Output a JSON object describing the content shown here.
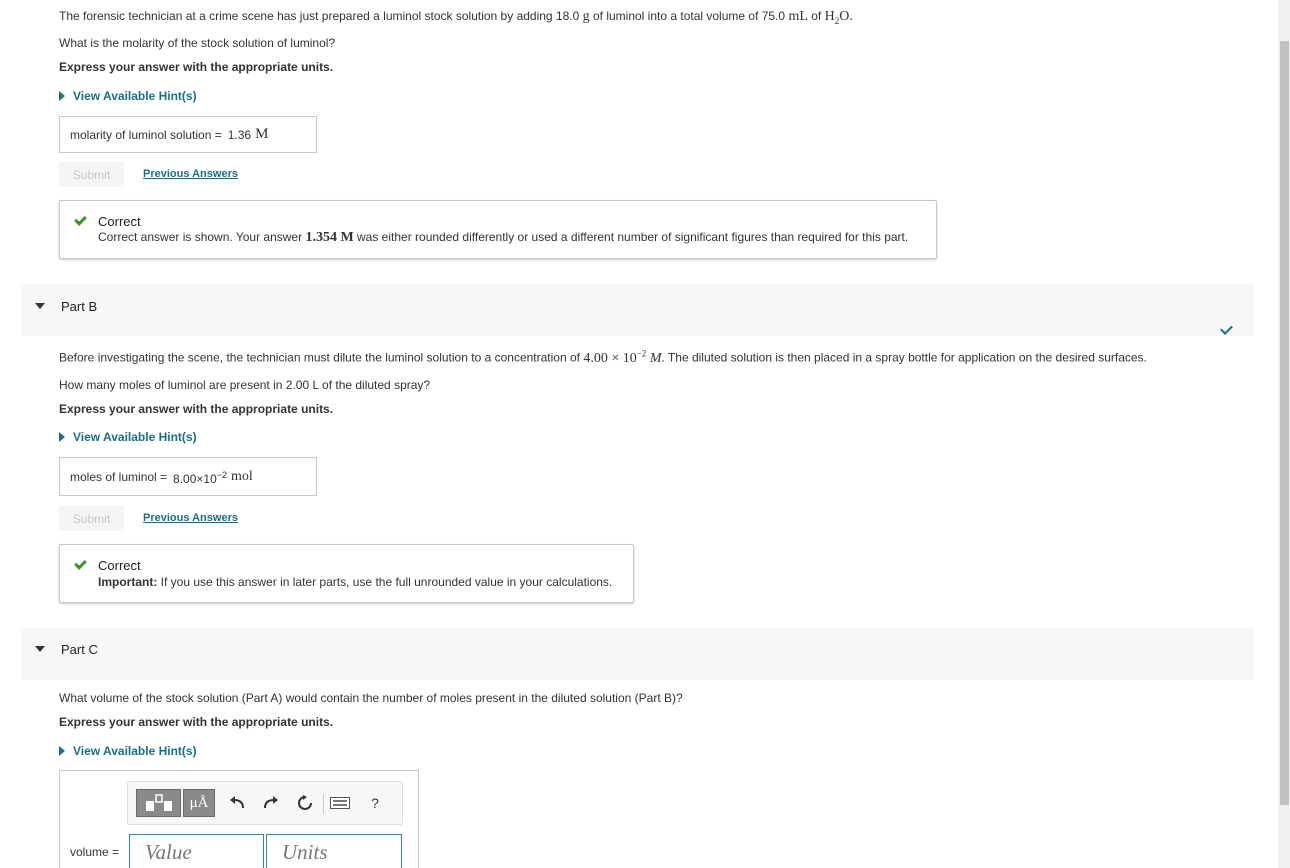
{
  "partA": {
    "question_prefix": "The forensic technician at a crime scene has just prepared a luminol stock solution by adding 18.0",
    "question_g": "g",
    "question_mid": "of luminol into a total volume of 75.0",
    "question_mL": "mL",
    "question_of": "of",
    "question_h2o": "H",
    "question_h2o_sub": "2",
    "question_h2o_end": "O.",
    "question2": "What is the molarity of the stock solution of luminol?",
    "instruction": "Express your answer with the appropriate units.",
    "hint_label": "View Available Hint(s)",
    "answer_label": "molarity of luminol solution =",
    "answer_value": "1.36",
    "answer_unit": "M",
    "submit_label": "Submit",
    "previous_answers_label": "Previous Answers",
    "feedback_title": "Correct",
    "feedback_prefix": "Correct answer is shown. Your answer",
    "feedback_value": "1.354 M",
    "feedback_suffix": "was either rounded differently or used a different number of significant figures than required for this part."
  },
  "partB": {
    "title": "Part B",
    "question_prefix": "Before investigating the scene, the technician must dilute the luminol solution to a concentration of",
    "question_conc": "4.00 × 10",
    "question_exp": "−2",
    "question_M": "M",
    "question_suffix": ". The diluted solution is then placed in a spray bottle for application on the desired surfaces.",
    "question2": "How many moles of luminol are present in 2.00 L of the diluted spray?",
    "instruction": "Express your answer with the appropriate units.",
    "hint_label": "View Available Hint(s)",
    "answer_label": "moles of luminol =",
    "answer_value": "8.00×10",
    "answer_exp": "−2",
    "answer_unit": "mol",
    "submit_label": "Submit",
    "previous_answers_label": "Previous Answers",
    "feedback_title": "Correct",
    "feedback_important": "Important:",
    "feedback_body": "If you use this answer in later parts, use the full unrounded value in your calculations."
  },
  "partC": {
    "title": "Part C",
    "question": "What volume of the stock solution (Part A) would contain the number of moles present in the diluted solution (Part B)?",
    "instruction": "Express your answer with the appropriate units.",
    "hint_label": "View Available Hint(s)",
    "toolbar_units_label": "μÅ",
    "toolbar_help_label": "?",
    "answer_label": "volume =",
    "value_placeholder": "Value",
    "units_placeholder": "Units"
  },
  "colors": {
    "link": "#1a6f87",
    "check": "#3e8e2a",
    "input_border": "#2b86a8"
  }
}
